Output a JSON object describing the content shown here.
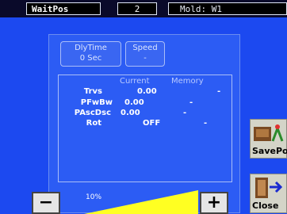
{
  "header": {
    "title": "WaitPos",
    "number": "2",
    "mold": "Mold: W1"
  },
  "params": {
    "dlytime": {
      "label": "DlyTime",
      "value": "0  Sec"
    },
    "speed": {
      "label": "Speed",
      "value": "-"
    }
  },
  "table": {
    "col_current": "Current",
    "col_memory": "Memory",
    "rows": [
      {
        "label": "Trvs",
        "current": "0.00",
        "memory": "-"
      },
      {
        "label": "PFwBw",
        "current": "0.00",
        "memory": "-"
      },
      {
        "label": "PAscDsc",
        "current": "0.00",
        "memory": "-"
      },
      {
        "label": "Rot",
        "current": "OFF",
        "memory": "-"
      }
    ]
  },
  "speed_control": {
    "percent_text": "10%",
    "level": 0.1,
    "minus": "−",
    "plus": "+"
  },
  "side": {
    "save_label": "SavePo",
    "close_label": "Close"
  },
  "colors": {
    "background": "#1c49f0",
    "panel": "#2c5cf4",
    "slider_fill": "#ffff22"
  }
}
